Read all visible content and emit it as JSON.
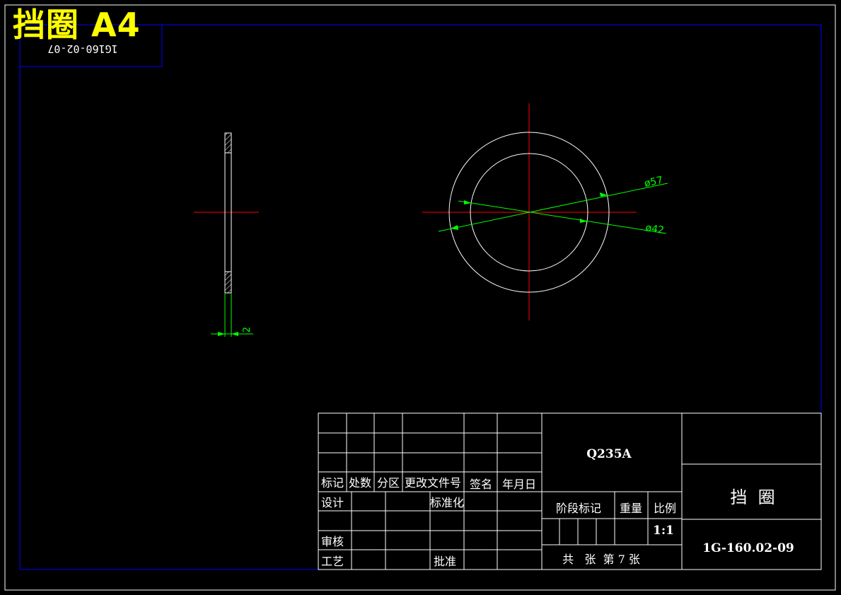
{
  "overlay": {
    "title": "挡圈 A4",
    "title_color": "#ffff00"
  },
  "colors": {
    "background": "#000000",
    "frame_outer": "#ffffff",
    "frame_inner": "#0000ff",
    "geometry": "#ffffff",
    "centerline": "#ff0000",
    "dimension": "#00ff00"
  },
  "drawing_code_box": {
    "text": "1G160-02-07",
    "mirrored": true
  },
  "side_view": {
    "thickness_dim": "2"
  },
  "front_view": {
    "outer_diameter_label": "ø57",
    "inner_diameter_label": "ø42"
  },
  "title_block": {
    "revision_headers": [
      "标记",
      "处数",
      "分区",
      "更改文件号",
      "签名",
      "年月日"
    ],
    "sign_rows": {
      "design": "设计",
      "standardize": "标准化",
      "review": "审核",
      "process": "工艺",
      "approve": "批准"
    },
    "material": "Q235A",
    "stage_mark_label": "阶段标记",
    "weight_label": "重量",
    "scale_label": "比例",
    "scale_value": "1:1",
    "sheet_info": "共   张  第 7 张",
    "part_name": "挡  圈",
    "drawing_number": "1G-160.02-09"
  }
}
